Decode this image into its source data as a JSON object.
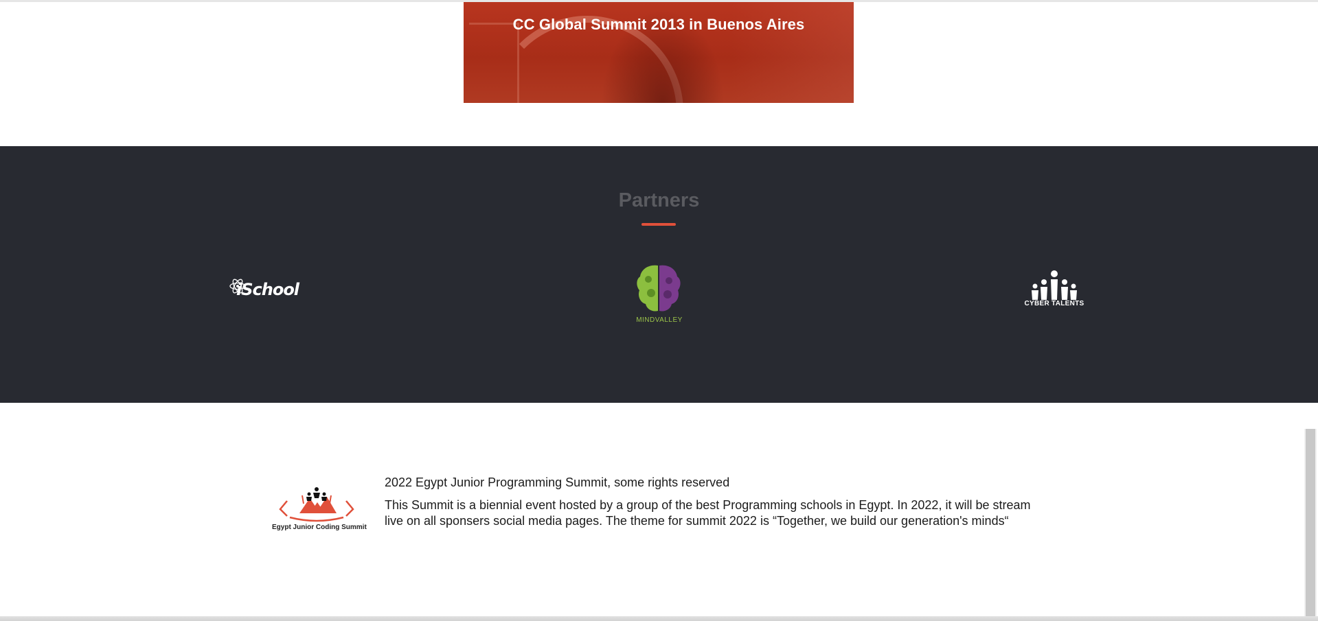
{
  "hero": {
    "title": "CC Global Summit 2013 in Buenos Aires"
  },
  "partners": {
    "title": "Partners",
    "logos": [
      {
        "name": "iSchool",
        "text": "iSchool"
      },
      {
        "name": "Mindvalley",
        "text": "MINDVALLEY"
      },
      {
        "name": "Cyber Talents",
        "text": "CYBER TALENTS"
      }
    ]
  },
  "footer": {
    "logo_caption": "Egypt Junior Coding Summit",
    "rights": "2022 Egypt Junior Programming Summit, some rights reserved",
    "description": "This Summit is a biennial event hosted by a group of the best Programming schools in Egypt. In 2022, it will be stream live on all sponsers social media pages. The theme for summit 2022 is “Together, we build our generation's minds“"
  },
  "colors": {
    "hero_red": "#b8351f",
    "partners_bg": "#282a31",
    "accent": "#e0503a",
    "mindvalley_green": "#9bc34a",
    "mindvalley_purple": "#7b3b8e"
  }
}
